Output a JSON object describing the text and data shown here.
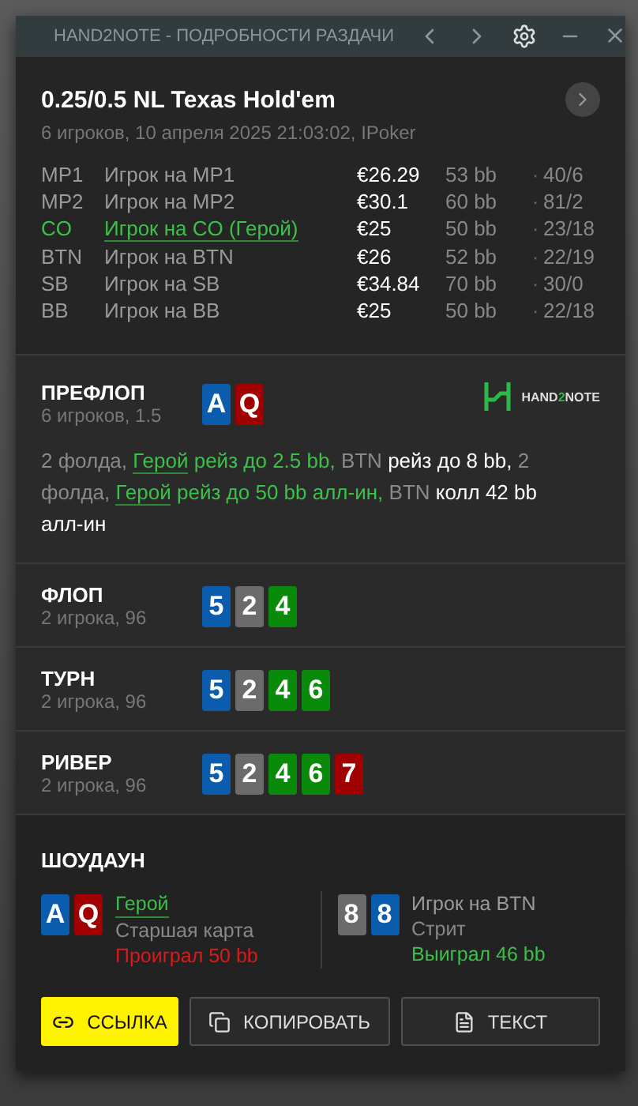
{
  "window": {
    "title": "HAND2NOTE - ПОДРОБНОСТИ РАЗДАЧИ"
  },
  "hand": {
    "title": "0.25/0.5 NL Texas Hold'em",
    "subtitle": "6 игроков, 10 апреля 2025 21:03:02, IPoker"
  },
  "players": [
    {
      "position": "MP1",
      "name": "Игрок на MP1",
      "stack": "€26.29",
      "bb": "53 bb",
      "stats": "40/6",
      "hero": false
    },
    {
      "position": "MP2",
      "name": "Игрок на MP2",
      "stack": "€30.1",
      "bb": "60 bb",
      "stats": "81/2",
      "hero": false
    },
    {
      "position": "CO",
      "name": "Игрок на CO (Герой)",
      "stack": "€25",
      "bb": "50 bb",
      "stats": "23/18",
      "hero": true
    },
    {
      "position": "BTN",
      "name": "Игрок на BTN",
      "stack": "€26",
      "bb": "52 bb",
      "stats": "22/19",
      "hero": false
    },
    {
      "position": "SB",
      "name": "Игрок на SB",
      "stack": "€34.84",
      "bb": "70 bb",
      "stats": "30/0",
      "hero": false
    },
    {
      "position": "BB",
      "name": "Игрок на BB",
      "stack": "€25",
      "bb": "50 bb",
      "stats": "22/18",
      "hero": false
    }
  ],
  "separator": "·",
  "logo": {
    "prefix": "HAND",
    "accent": "2",
    "suffix": "NOTE"
  },
  "preflop": {
    "title": "ПРЕФЛОП",
    "subtitle": "6 игроков, 1.5",
    "cards": [
      {
        "rank": "A",
        "color": "#0b5cad"
      },
      {
        "rank": "Q",
        "color": "#a00000"
      }
    ],
    "actions": [
      {
        "text": "2 фолда, ",
        "kind": "muted"
      },
      {
        "text": "Герой",
        "kind": "hero_link"
      },
      {
        "text": " рейз до 2.5 bb,",
        "kind": "hero"
      },
      {
        "text": " BTN",
        "kind": "muted"
      },
      {
        "text": " рейз до 8 bb,",
        "kind": "action"
      },
      {
        "text": " 2 фолда, ",
        "kind": "muted"
      },
      {
        "text": "Герой",
        "kind": "hero_link"
      },
      {
        "text": " рейз до 50 bb алл-ин,",
        "kind": "hero"
      },
      {
        "text": " BTN",
        "kind": "muted"
      },
      {
        "text": " колл 42 bb алл-ин",
        "kind": "action"
      }
    ]
  },
  "streets": [
    {
      "title": "ФЛОП",
      "subtitle": "2 игрока, 96",
      "cards": [
        {
          "rank": "5",
          "color": "#0b5cad"
        },
        {
          "rank": "2",
          "color": "#6b6b6b"
        },
        {
          "rank": "4",
          "color": "#0a8a0a"
        }
      ]
    },
    {
      "title": "ТУРН",
      "subtitle": "2 игрока, 96",
      "cards": [
        {
          "rank": "5",
          "color": "#0b5cad"
        },
        {
          "rank": "2",
          "color": "#6b6b6b"
        },
        {
          "rank": "4",
          "color": "#0a8a0a"
        },
        {
          "rank": "6",
          "color": "#0a8a0a"
        }
      ]
    },
    {
      "title": "РИВЕР",
      "subtitle": "2 игрока, 96",
      "cards": [
        {
          "rank": "5",
          "color": "#0b5cad"
        },
        {
          "rank": "2",
          "color": "#6b6b6b"
        },
        {
          "rank": "4",
          "color": "#0a8a0a"
        },
        {
          "rank": "6",
          "color": "#0a8a0a"
        },
        {
          "rank": "7",
          "color": "#a00000"
        }
      ]
    }
  ],
  "showdown": {
    "title": "ШОУДАУН",
    "players": [
      {
        "name": "Герой",
        "hero": true,
        "hand": "Старшая карта",
        "result": "Проиграл 50 bb",
        "won": false,
        "cards": [
          {
            "rank": "A",
            "color": "#0b5cad"
          },
          {
            "rank": "Q",
            "color": "#a00000"
          }
        ]
      },
      {
        "name": "Игрок на BTN",
        "hero": false,
        "hand": "Стрит",
        "result": "Выиграл 46 bb",
        "won": true,
        "cards": [
          {
            "rank": "8",
            "color": "#6b6b6b"
          },
          {
            "rank": "8",
            "color": "#0b5cad"
          }
        ]
      }
    ]
  },
  "buttons": [
    {
      "label": "ССЫЛКА",
      "kind": "link"
    },
    {
      "label": "КОПИРОВАТЬ",
      "kind": "copy"
    },
    {
      "label": "ТЕКСТ",
      "kind": "text"
    }
  ]
}
